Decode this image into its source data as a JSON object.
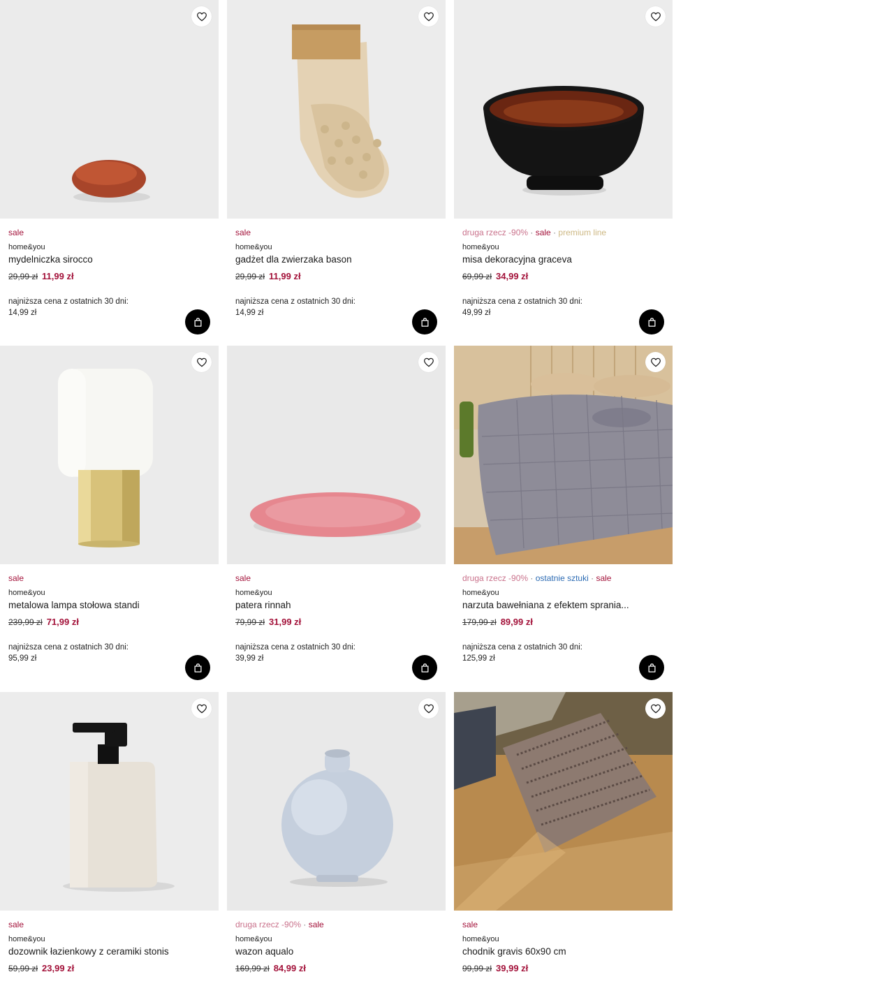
{
  "products": [
    {
      "tags": [
        {
          "text": "sale",
          "kind": "sale"
        }
      ],
      "brand": "home&you",
      "name": "mydelniczka sirocco",
      "old_price": "29,99 zł",
      "new_price": "11,99 zł",
      "lowest_label": "najniższa cena z ostatnich 30 dni:",
      "lowest_value": "14,99 zł",
      "image": "soap-dish",
      "cart": true
    },
    {
      "tags": [
        {
          "text": "sale",
          "kind": "sale"
        }
      ],
      "brand": "home&you",
      "name": "gadżet dla zwierzaka bason",
      "old_price": "29,99 zł",
      "new_price": "11,99 zł",
      "lowest_label": "najniższa cena z ostatnich 30 dni:",
      "lowest_value": "14,99 zł",
      "image": "pet-glove",
      "cart": true
    },
    {
      "tags": [
        {
          "text": "druga rzecz -90%",
          "kind": "second"
        },
        {
          "text": "sale",
          "kind": "sale"
        },
        {
          "text": "premium line",
          "kind": "premium"
        }
      ],
      "brand": "home&you",
      "name": "misa dekoracyjna graceva",
      "old_price": "69,99 zł",
      "new_price": "34,99 zł",
      "lowest_label": "najniższa cena z ostatnich 30 dni:",
      "lowest_value": "49,99 zł",
      "image": "wooden-bowl",
      "cart": true
    },
    {
      "tags": [
        {
          "text": "sale",
          "kind": "sale"
        }
      ],
      "brand": "home&you",
      "name": "metalowa lampa stołowa standi",
      "old_price": "239,99 zł",
      "new_price": "71,99 zł",
      "lowest_label": "najniższa cena z ostatnich 30 dni:",
      "lowest_value": "95,99 zł",
      "image": "table-lamp",
      "cart": true
    },
    {
      "tags": [
        {
          "text": "sale",
          "kind": "sale"
        }
      ],
      "brand": "home&you",
      "name": "patera rinnah",
      "old_price": "79,99 zł",
      "new_price": "31,99 zł",
      "lowest_label": "najniższa cena z ostatnich 30 dni:",
      "lowest_value": "39,99 zł",
      "image": "pink-plate",
      "cart": true
    },
    {
      "tags": [
        {
          "text": "druga rzecz -90%",
          "kind": "second"
        },
        {
          "text": "ostatnie sztuki",
          "kind": "last"
        },
        {
          "text": "sale",
          "kind": "sale"
        }
      ],
      "brand": "home&you",
      "name": "narzuta bawełniana z efektem sprania...",
      "old_price": "179,99 zł",
      "new_price": "89,99 zł",
      "lowest_label": "najniższa cena z ostatnich 30 dni:",
      "lowest_value": "125,99 zł",
      "image": "bedspread",
      "cart": true
    },
    {
      "tags": [
        {
          "text": "sale",
          "kind": "sale"
        }
      ],
      "brand": "home&you",
      "name": "dozownik łazienkowy z ceramiki stonis",
      "old_price": "59,99 zł",
      "new_price": "23,99 zł",
      "image": "soap-dispenser",
      "cart": false
    },
    {
      "tags": [
        {
          "text": "druga rzecz -90%",
          "kind": "second"
        },
        {
          "text": "sale",
          "kind": "sale"
        }
      ],
      "brand": "home&you",
      "name": "wazon aqualo",
      "old_price": "169,99 zł",
      "new_price": "84,99 zł",
      "image": "vase",
      "cart": false
    },
    {
      "tags": [
        {
          "text": "sale",
          "kind": "sale"
        }
      ],
      "brand": "home&you",
      "name": "chodnik gravis 60x90 cm",
      "old_price": "99,99 zł",
      "new_price": "39,99 zł",
      "image": "rug",
      "cart": false
    }
  ],
  "icons": {
    "favorite": "heart-icon",
    "cart": "shopping-bag-icon"
  },
  "colors": {
    "sale": "#a3123a",
    "second": "#c9718b",
    "last": "#2c6bb3",
    "premium": "#cdb883",
    "cart_bg": "#000000"
  }
}
